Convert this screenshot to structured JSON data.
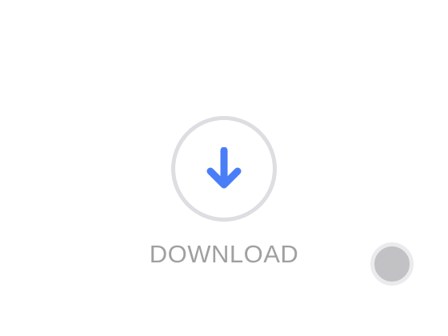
{
  "download": {
    "label": "DOWNLOAD",
    "icon": "arrow-down-icon"
  },
  "floating_button": {
    "icon": "circle"
  },
  "colors": {
    "accent": "#4a7ef7",
    "ring": "#dddde2",
    "label": "#a0a0a3",
    "floating_fill": "#c2c2c4"
  }
}
